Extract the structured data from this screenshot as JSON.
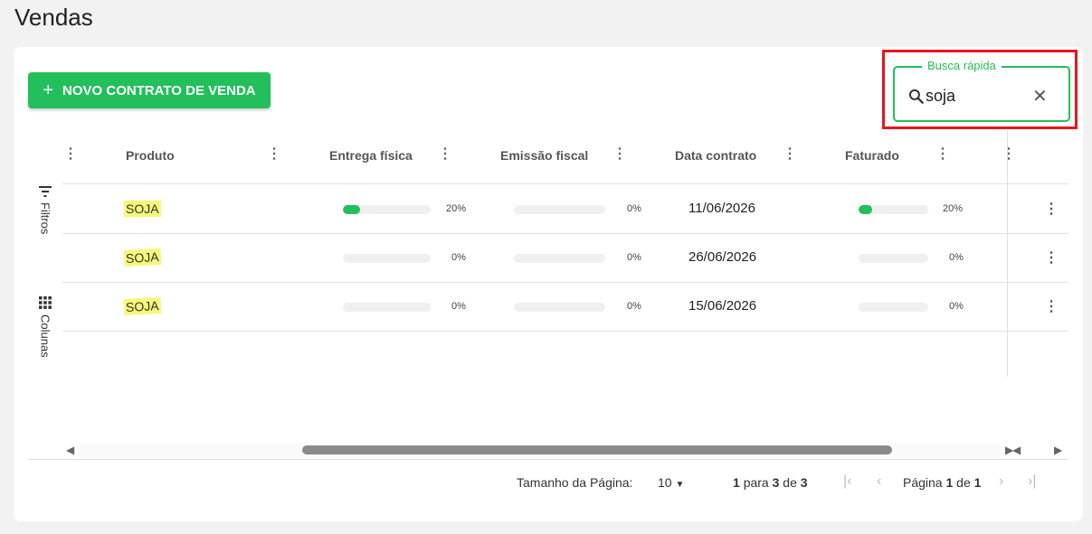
{
  "page": {
    "title": "Vendas"
  },
  "toolbar": {
    "new_label": "NOVO CONTRATO DE VENDA",
    "new_icon": "plus-icon"
  },
  "search": {
    "legend": "Busca rápida",
    "value": "soja",
    "clear": "✕"
  },
  "sidebar": {
    "filters_label": "Filtros",
    "columns_label": "Colunas"
  },
  "columns": [
    "Produto",
    "Entrega física",
    "Emissão fiscal",
    "Data contrato",
    "Faturado"
  ],
  "rows": [
    {
      "produto": "SOJA",
      "entrega_pct": 20,
      "entrega_label": "20%",
      "emissao_pct": 0,
      "emissao_label": "0%",
      "data": "11/06/2026",
      "faturado_pct": 20,
      "faturado_label": "20%"
    },
    {
      "produto": "SOJA",
      "entrega_pct": 0,
      "entrega_label": "0%",
      "emissao_pct": 0,
      "emissao_label": "0%",
      "data": "26/06/2026",
      "faturado_pct": 0,
      "faturado_label": "0%"
    },
    {
      "produto": "SOJA",
      "entrega_pct": 0,
      "entrega_label": "0%",
      "emissao_pct": 0,
      "emissao_label": "0%",
      "data": "15/06/2026",
      "faturado_pct": 0,
      "faturado_label": "0%"
    }
  ],
  "footer": {
    "page_size_label": "Tamanho da Página:",
    "page_size_value": "10",
    "range_from": "1",
    "range_to_word": "para",
    "range_to": "3",
    "range_of_word": "de",
    "range_total": "3",
    "page_word": "Página",
    "page_current": "1",
    "page_of_word": "de",
    "page_total": "1"
  },
  "colors": {
    "accent": "#22bf5b",
    "highlight": "#f7f77a",
    "focus_frame": "#e8151b"
  }
}
